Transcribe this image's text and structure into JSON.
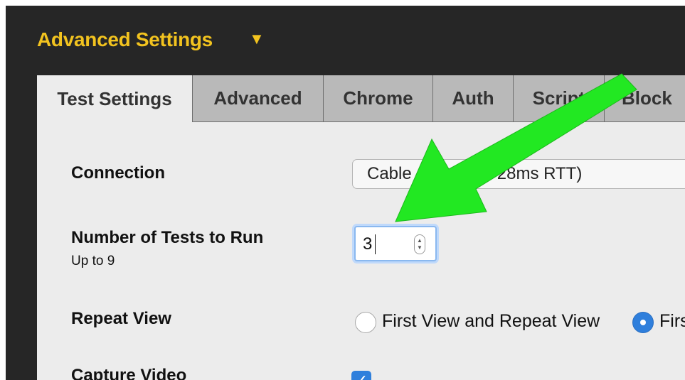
{
  "header": {
    "title": "Advanced Settings",
    "toggle_glyph": "▼",
    "accent_color": "#f2c31f"
  },
  "tabs": [
    {
      "label": "Test Settings",
      "active": true
    },
    {
      "label": "Advanced",
      "active": false
    },
    {
      "label": "Chrome",
      "active": false
    },
    {
      "label": "Auth",
      "active": false
    },
    {
      "label": "Script",
      "active": false
    },
    {
      "label": "Block",
      "active": false
    }
  ],
  "form": {
    "connection": {
      "label": "Connection",
      "selected_value": "Cable (5/1 Mbps 28ms RTT)"
    },
    "number_of_tests": {
      "label": "Number of Tests to Run",
      "sublabel": "Up to 9",
      "value": "3"
    },
    "repeat_view": {
      "label": "Repeat View",
      "options": [
        {
          "label": "First View and Repeat View",
          "selected": false
        },
        {
          "label": "First View Only",
          "selected": true
        }
      ]
    },
    "capture_video": {
      "label": "Capture Video",
      "checked": true
    }
  },
  "annotation": {
    "type": "arrow",
    "color": "#22e822",
    "target": "number-of-tests-input"
  }
}
